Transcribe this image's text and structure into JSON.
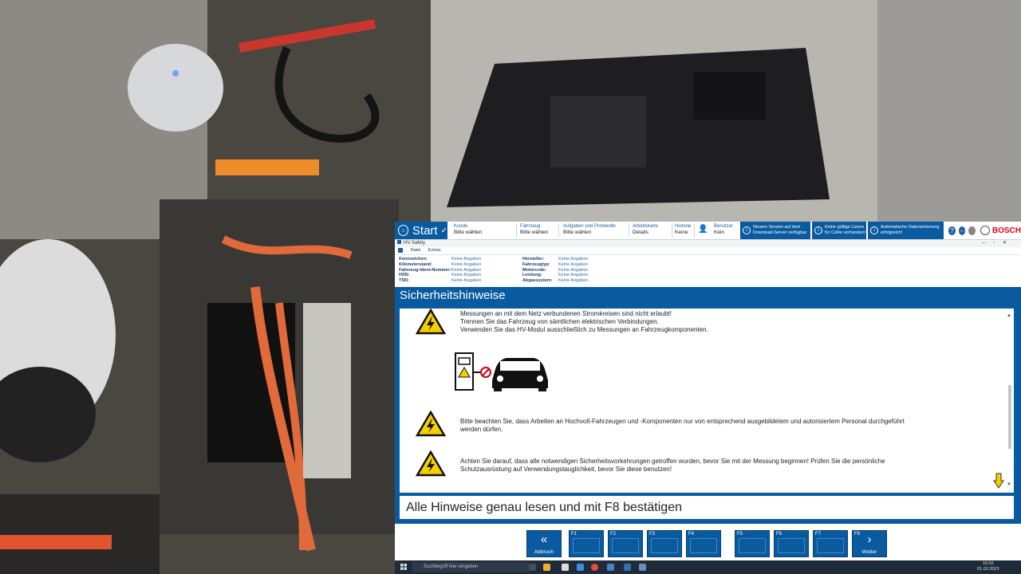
{
  "topbar": {
    "start_label": "Start",
    "items": [
      {
        "title": "Kunde",
        "value": "Bitte wählen"
      },
      {
        "title": "Fahrzeug",
        "value": "Bitte wählen"
      },
      {
        "title": "Aufgaben und Protokolle",
        "value": "Bitte wählen"
      },
      {
        "title": "Arbeitskarte",
        "value": "Details"
      },
      {
        "title": "Historie",
        "value": "Keine"
      },
      {
        "title": "Benutzer",
        "value": "Kein"
      }
    ],
    "notices": [
      {
        "line1": "Neuere Version auf dem",
        "line2": "Download-Server verfügbar"
      },
      {
        "line1": "Keine gültige Lizenz",
        "line2": "für CoRe vorhanden!"
      },
      {
        "line1": "Automatische Datensicherung",
        "line2": "erfolgreich!"
      }
    ],
    "help_label": "?",
    "minimize_label": "–",
    "brand": "BOSCH"
  },
  "window": {
    "title": "HV Safety",
    "menu": [
      "Datei",
      "Extras"
    ]
  },
  "vehicle_info": {
    "left": [
      {
        "key": "Kennzeichen:",
        "value": "Keine Angaben"
      },
      {
        "key": "Kilometerstand:",
        "value": "Keine Angaben"
      },
      {
        "key": "Fahrzeug-Ident-Nummer:",
        "value": "Keine Angaben"
      },
      {
        "key": "HSN:",
        "value": "Keine Angaben"
      },
      {
        "key": "TSN:",
        "value": "Keine Angaben"
      }
    ],
    "right": [
      {
        "key": "Hersteller:",
        "value": "Keine Angaben"
      },
      {
        "key": "Fahrzeugtyp:",
        "value": "Keine Angaben"
      },
      {
        "key": "Motorcode:",
        "value": "Keine Angaben"
      },
      {
        "key": "Leistung:",
        "value": "Keine Angaben"
      },
      {
        "key": "Abgassystem:",
        "value": "Keine Angaben"
      }
    ]
  },
  "section": {
    "title": "Sicherheitshinweise",
    "notes": [
      {
        "line1": "Messungen an mit dem Netz verbundenen Stromkreisen sind nicht erlaubt!",
        "line2": "Trennen Sie das Fahrzeug von sämtlichen elektrischen Verbindungen.",
        "line3": "Verwenden Sie das HV-Modul ausschließlich zu Messungen an Fahrzeugkomponenten."
      },
      {
        "line1": "Bitte beachten Sie, dass Arbeiten an Hochvolt-Fahrzeugen und -Komponenten nur von entsprechend ausgebildetem und autorisiertem Personal durchgeführt",
        "line2": "werden dürfen."
      },
      {
        "line1": "Achten Sie darauf, dass alle notwendigen Sicherheitsvorkehrungen getroffen wurden, bevor Sie mit der Messung beginnen! Prüfen Sie die persönliche",
        "line2": "Schutzausrüstung auf Verwendungstauglichkeit, bevor Sie diese benutzen!"
      }
    ],
    "footer_message": "Alle Hinweise genau lesen und mit F8 bestätigen"
  },
  "fkeys": [
    {
      "num": "",
      "label": "Abbruch"
    },
    {
      "num": "F1",
      "label": ""
    },
    {
      "num": "F2",
      "label": ""
    },
    {
      "num": "F3",
      "label": ""
    },
    {
      "num": "F4",
      "label": ""
    },
    {
      "num": "F5",
      "label": ""
    },
    {
      "num": "F6",
      "label": ""
    },
    {
      "num": "F7",
      "label": ""
    },
    {
      "num": "F8",
      "label": "Weiter"
    }
  ],
  "taskbar": {
    "search_placeholder": "Suchbegriff hier eingeben",
    "time": "16:02",
    "date": "01.02.2023"
  },
  "colors": {
    "accent": "#0a5aa0",
    "warning_yellow": "#f5d000",
    "brand_red": "#e2001a"
  }
}
